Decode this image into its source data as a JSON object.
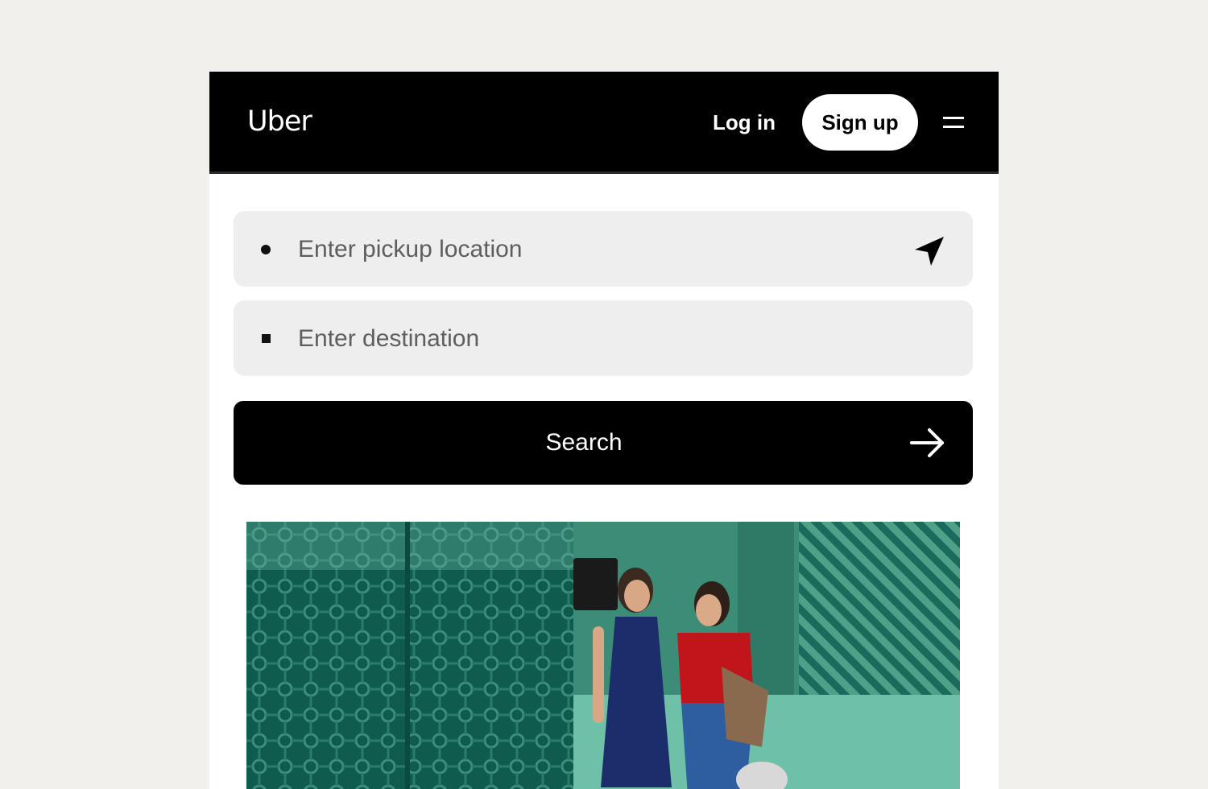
{
  "header": {
    "logo": "Uber",
    "login_label": "Log in",
    "signup_label": "Sign up"
  },
  "form": {
    "pickup_placeholder": "Enter pickup location",
    "destination_placeholder": "Enter destination",
    "search_label": "Search"
  },
  "icons": {
    "menu": "menu-icon",
    "locate": "location-arrow-icon",
    "arrow": "arrow-right-icon"
  },
  "colors": {
    "page_bg": "#f1f0ed",
    "topbar": "#000000",
    "field_bg": "#eeeeee",
    "hero_teal": "#1f6b5b"
  }
}
